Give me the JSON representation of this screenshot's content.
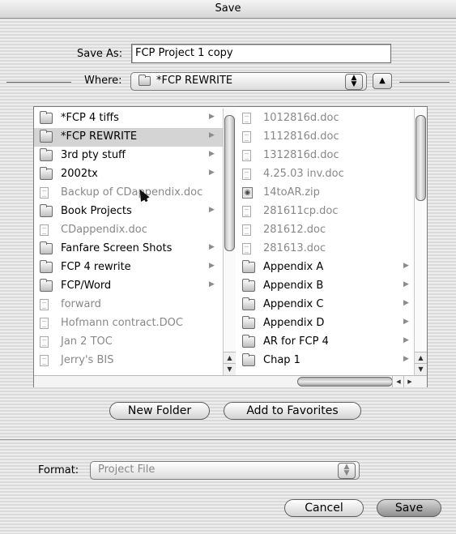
{
  "window": {
    "title": "Save"
  },
  "save_as": {
    "label": "Save As:",
    "value": "FCP Project 1 copy"
  },
  "where": {
    "label": "Where:",
    "value": "*FCP REWRITE",
    "folder_icon": "folder-icon",
    "collapse_icon": "triangle-up-icon"
  },
  "browser": {
    "left_column": [
      {
        "name": "*FCP 4 tiffs",
        "kind": "folder",
        "has_arrow": true,
        "selected": false
      },
      {
        "name": "*FCP REWRITE",
        "kind": "folder",
        "has_arrow": true,
        "selected": true
      },
      {
        "name": "3rd pty stuff",
        "kind": "folder",
        "has_arrow": true,
        "selected": false
      },
      {
        "name": "2002tx",
        "kind": "folder",
        "has_arrow": true,
        "selected": false
      },
      {
        "name": "Backup of CDappendix.doc",
        "kind": "doc",
        "has_arrow": false,
        "selected": false
      },
      {
        "name": "Book Projects",
        "kind": "folder",
        "has_arrow": true,
        "selected": false
      },
      {
        "name": "CDappendix.doc",
        "kind": "doc",
        "has_arrow": false,
        "selected": false
      },
      {
        "name": "Fanfare Screen Shots",
        "kind": "folder",
        "has_arrow": true,
        "selected": false
      },
      {
        "name": "FCP 4 rewrite",
        "kind": "folder",
        "has_arrow": true,
        "selected": false
      },
      {
        "name": "FCP/Word",
        "kind": "folder",
        "has_arrow": true,
        "selected": false
      },
      {
        "name": "forward",
        "kind": "doc",
        "has_arrow": false,
        "selected": false
      },
      {
        "name": "Hofmann contract.DOC",
        "kind": "doc",
        "has_arrow": false,
        "selected": false
      },
      {
        "name": "Jan 2 TOC",
        "kind": "doc",
        "has_arrow": false,
        "selected": false
      },
      {
        "name": "Jerry's BIS",
        "kind": "doc",
        "has_arrow": false,
        "selected": false
      }
    ],
    "right_column": [
      {
        "name": "1012816d.doc",
        "kind": "doc",
        "has_arrow": false
      },
      {
        "name": "1112816d.doc",
        "kind": "doc",
        "has_arrow": false
      },
      {
        "name": "1312816d.doc",
        "kind": "doc",
        "has_arrow": false
      },
      {
        "name": "4.25.03 inv.doc",
        "kind": "doc",
        "has_arrow": false
      },
      {
        "name": "14toAR.zip",
        "kind": "zip",
        "has_arrow": false
      },
      {
        "name": "281611cp.doc",
        "kind": "doc",
        "has_arrow": false
      },
      {
        "name": "281612.doc",
        "kind": "doc",
        "has_arrow": false
      },
      {
        "name": "281613.doc",
        "kind": "doc",
        "has_arrow": false
      },
      {
        "name": "Appendix A",
        "kind": "folder",
        "has_arrow": true
      },
      {
        "name": "Appendix B",
        "kind": "folder",
        "has_arrow": true
      },
      {
        "name": "Appendix C",
        "kind": "folder",
        "has_arrow": true
      },
      {
        "name": "Appendix D",
        "kind": "folder",
        "has_arrow": true
      },
      {
        "name": "AR for FCP 4",
        "kind": "folder",
        "has_arrow": true
      },
      {
        "name": "Chap 1",
        "kind": "folder",
        "has_arrow": true
      }
    ]
  },
  "buttons": {
    "new_folder": "New Folder",
    "add_to_favorites": "Add to Favorites",
    "cancel": "Cancel",
    "save": "Save"
  },
  "format": {
    "label": "Format:",
    "value": "Project File"
  },
  "colors": {
    "selection": "#d4d4d4",
    "dimmed_text": "#888888"
  }
}
